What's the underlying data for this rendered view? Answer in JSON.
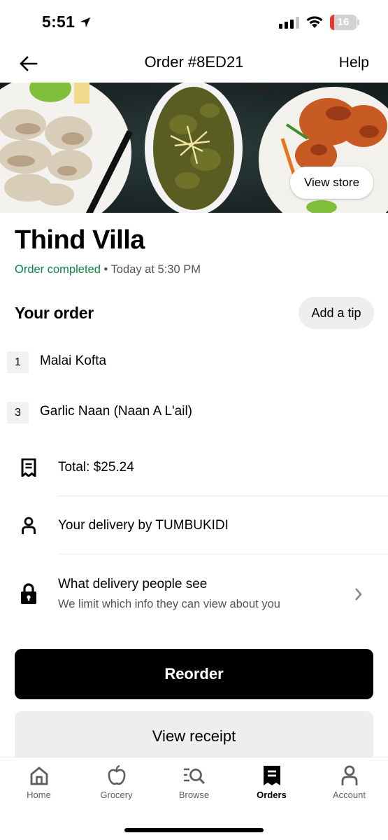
{
  "status_bar": {
    "time": "5:51",
    "battery_level": "16",
    "battery_fraction": 0.16
  },
  "header": {
    "title": "Order #8ED21",
    "help_label": "Help"
  },
  "hero": {
    "view_store_label": "View store"
  },
  "store": {
    "name": "Thind Villa",
    "status": "Order completed",
    "separator": " • ",
    "time": "Today at 5:30 PM"
  },
  "order": {
    "heading": "Your order",
    "add_tip_label": "Add a tip",
    "items": [
      {
        "qty": "1",
        "name": "Malai Kofta"
      },
      {
        "qty": "3",
        "name": "Garlic Naan (Naan A L'ail)"
      }
    ]
  },
  "details": {
    "total": "Total: $25.24",
    "delivery": "Your delivery by TUMBUKIDI",
    "privacy_title": "What delivery people see",
    "privacy_sub": "We limit which info they can view about you"
  },
  "actions": {
    "reorder_label": "Reorder",
    "receipt_label": "View receipt"
  },
  "tabs": [
    {
      "label": "Home",
      "icon": "home-icon",
      "active": false
    },
    {
      "label": "Grocery",
      "icon": "apple-icon",
      "active": false
    },
    {
      "label": "Browse",
      "icon": "browse-icon",
      "active": false
    },
    {
      "label": "Orders",
      "icon": "receipt-icon",
      "active": true
    },
    {
      "label": "Account",
      "icon": "person-icon",
      "active": false
    }
  ],
  "colors": {
    "status_green": "#0e8345",
    "primary_button": "#000000",
    "secondary_button": "#eeeeee",
    "battery_red": "#e53935"
  }
}
